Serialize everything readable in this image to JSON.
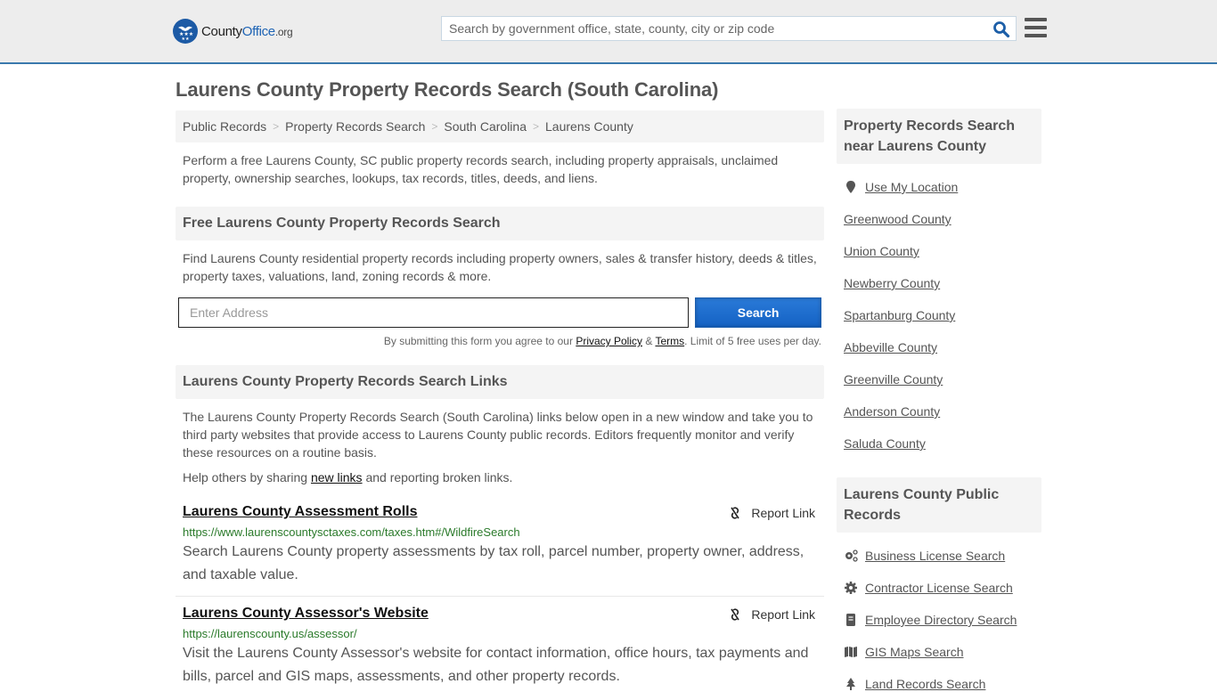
{
  "header": {
    "logo": {
      "name_part1": "County",
      "name_part2": "Office",
      "name_suffix": ".org"
    },
    "search": {
      "placeholder": "Search by government office, state, county, city or zip code",
      "value": ""
    },
    "brand_color": "#1d63b4",
    "header_border_color": "#3a79ad"
  },
  "page": {
    "title": "Laurens County Property Records Search (South Carolina)"
  },
  "breadcrumb": [
    {
      "label": "Public Records"
    },
    {
      "label": "Property Records Search"
    },
    {
      "label": "South Carolina"
    },
    {
      "label": "Laurens County"
    }
  ],
  "intro": "Perform a free Laurens County, SC public property records search, including property appraisals, unclaimed property, ownership searches, lookups, tax records, titles, deeds, and liens.",
  "free_search": {
    "heading": "Free Laurens County Property Records Search",
    "text": "Find Laurens County residential property records including property owners, sales & transfer history, deeds & titles, property taxes, valuations, land, zoning records & more.",
    "address_placeholder": "Enter Address",
    "address_value": "",
    "button_label": "Search",
    "disclaimer_before": "By submitting this form you agree to our ",
    "privacy_label": "Privacy Policy",
    "amp": " & ",
    "terms_label": "Terms",
    "disclaimer_after": ". Limit of 5 free uses per day."
  },
  "links_section": {
    "heading": "Laurens County Property Records Search Links",
    "text": "The Laurens County Property Records Search (South Carolina) links below open in a new window and take you to third party websites that provide access to Laurens County public records. Editors frequently monitor and verify these resources on a routine basis.",
    "help_before": "Help others by sharing ",
    "help_link": "new links",
    "help_after": " and reporting broken links.",
    "report_label": "Report Link",
    "results": [
      {
        "title": "Laurens County Assessment Rolls",
        "url": "https://www.laurenscountysctaxes.com/taxes.htm#/WildfireSearch",
        "description": "Search Laurens County property assessments by tax roll, parcel number, property owner, address, and taxable value."
      },
      {
        "title": "Laurens County Assessor's Website",
        "url": "https://laurenscounty.us/assessor/",
        "description": "Visit the Laurens County Assessor's website for contact information, office hours, tax payments and bills, parcel and GIS maps, assessments, and other property records."
      }
    ]
  },
  "sidebar": {
    "nearby_heading": "Property Records Search near Laurens County",
    "use_location": "Use My Location",
    "nearby": [
      "Greenwood County",
      "Union County",
      "Newberry County",
      "Spartanburg County",
      "Abbeville County",
      "Greenville County",
      "Anderson County",
      "Saluda County"
    ],
    "public_heading": "Laurens County Public Records",
    "public_records": [
      {
        "label": "Business License Search",
        "icon": "cogs-icon"
      },
      {
        "label": "Contractor License Search",
        "icon": "gear-icon"
      },
      {
        "label": "Employee Directory Search",
        "icon": "book-icon"
      },
      {
        "label": "GIS Maps Search",
        "icon": "map-icon"
      },
      {
        "label": "Land Records Search",
        "icon": "tree-icon"
      }
    ]
  }
}
